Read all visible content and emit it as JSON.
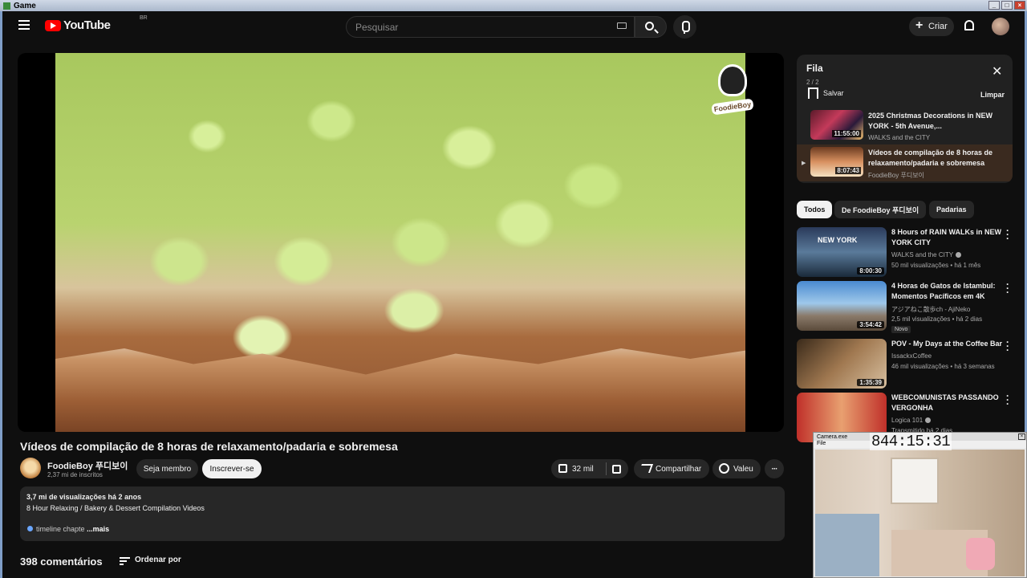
{
  "window": {
    "title": "Game"
  },
  "header": {
    "logo_text": "YouTube",
    "country_code": "BR",
    "search_placeholder": "Pesquisar",
    "create_label": "Criar"
  },
  "video": {
    "title": "Vídeos de compilação de 8 horas de relaxamento/padaria e sobremesa",
    "overlay_brand": "FoodieBoy",
    "channel_name": "FoodieBoy 푸디보이",
    "subscribers": "2,37 mi de inscritos",
    "member_label": "Seja membro",
    "subscribe_label": "Inscrever-se",
    "likes": "32 mil",
    "share_label": "Compartilhar",
    "thanks_label": "Valeu",
    "more_label": "···"
  },
  "description": {
    "meta": "3,7 mi de visualizações  há 2 anos",
    "line1": "8 Hour Relaxing / Bakery & Dessert Compilation Videos",
    "chapter_text": "timeline chapte",
    "more": "...mais"
  },
  "comments": {
    "count": "398 comentários",
    "sort_label": "Ordenar por"
  },
  "queue": {
    "title": "Fila",
    "position": "2 / 2",
    "save_label": "Salvar",
    "clear_label": "Limpar",
    "items": [
      {
        "title": "2025 Christmas Decorations in NEW YORK - 5th Avenue,...",
        "channel": "WALKS and the CITY",
        "duration": "11:55:00"
      },
      {
        "title": "Vídeos de compilação de 8 horas de relaxamento/padaria e sobremesa",
        "channel": "FoodieBoy 푸디보이",
        "duration": "8:07:43"
      }
    ]
  },
  "chips": [
    "Todos",
    "De FoodieBoy 푸디보이",
    "Padarias"
  ],
  "recommendations": [
    {
      "title": "8 Hours of RAIN WALKs in NEW YORK CITY",
      "thumb_text": "NEW YORK",
      "channel": "WALKS and the CITY",
      "views": "50 mil visualizações • há 1 mês",
      "duration": "8:00:30",
      "badge": ""
    },
    {
      "title": "4 Horas de Gatos de Istambul: Momentos Pacíficos em 4K",
      "channel": "アジアねこ散歩ch - AjiNeko",
      "views": "2,5 mil visualizações • há 2 dias",
      "duration": "3:54:42",
      "badge": "Novo"
    },
    {
      "title": "POV - My Days at the Coffee Bar",
      "channel": "IssackxCoffee",
      "views": "46 mil visualizações • há 3 semanas",
      "duration": "1:35:39",
      "badge": ""
    },
    {
      "title": "WEBCOMUNISTAS PASSANDO VERGONHA",
      "channel": "Logica 101",
      "views": "Transmitido há 2 dias",
      "duration": "",
      "badge": ""
    }
  ],
  "camera": {
    "title": "Camera.exe",
    "menu": "File",
    "timer": "844:15:31"
  }
}
